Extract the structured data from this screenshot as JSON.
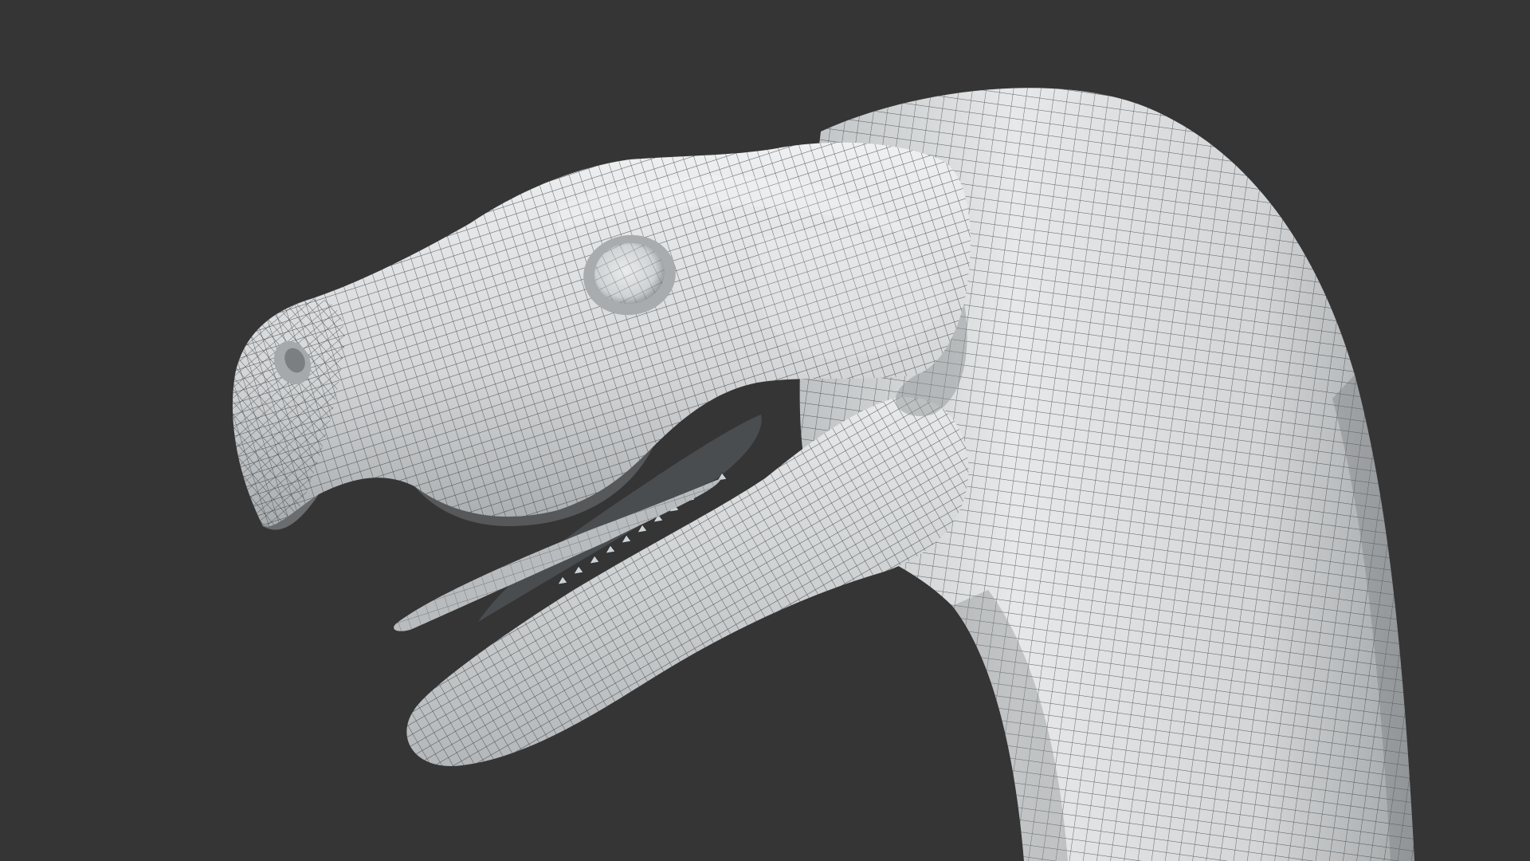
{
  "scene": {
    "subject": "dinosaur-head-wireframe-model",
    "colors": {
      "background": "#353535",
      "skin": "#d9dbdc",
      "skin_shadow": "#9a9d9f",
      "skin_highlight": "#f4f5f6",
      "wire": "#2b3236",
      "mouth_interior": "#4a4d50",
      "tongue": "#b9bcbe",
      "teeth": "#cfd2d4"
    }
  }
}
